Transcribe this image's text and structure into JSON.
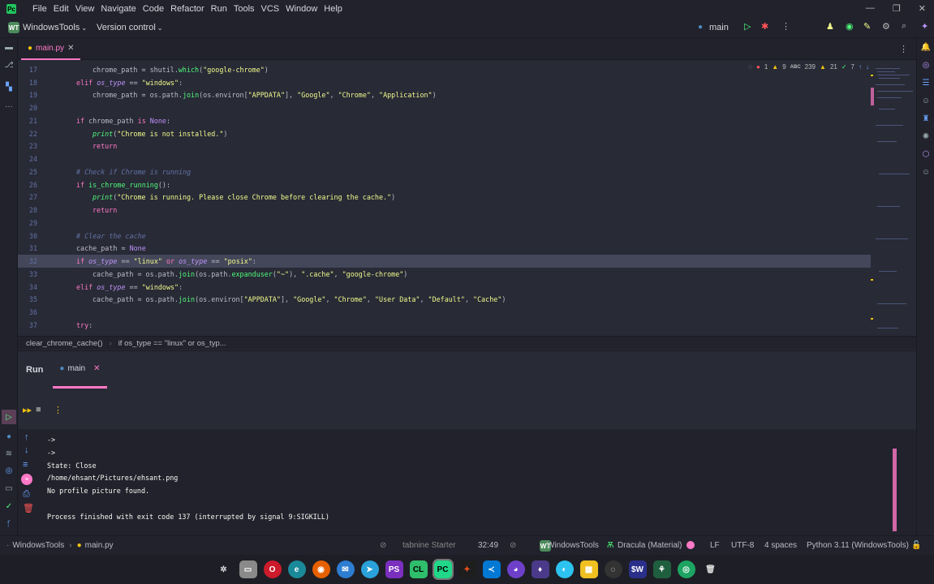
{
  "menu": [
    "File",
    "Edit",
    "View",
    "Navigate",
    "Code",
    "Refactor",
    "Run",
    "Tools",
    "VCS",
    "Window",
    "Help"
  ],
  "toolbar": {
    "project_badge": "WT",
    "project": "WindowsTools",
    "vcs": "Version control",
    "run_config": "main"
  },
  "tab": {
    "filename": "main.py"
  },
  "inspections": {
    "errors": "1",
    "warnings": "9",
    "typos": "239",
    "weak": "21",
    "ok": "7"
  },
  "lines": [
    {
      "n": "17",
      "cur": false,
      "html": "<span style='margin-left:20px'></span>chrome_path = shutil.<span class='fn'>which</span>(<span class='str'>\"google-chrome\"</span>)"
    },
    {
      "n": "18",
      "cur": false,
      "html": "<span class='kw'>elif</span> <span class='var'>os_type</span> == <span class='str'>\"windows\"</span>:"
    },
    {
      "n": "19",
      "cur": false,
      "html": "<span style='margin-left:20px'></span>chrome_path = os.path.<span class='fn'>join</span>(os.environ[<span class='str'>\"APPDATA\"</span>], <span class='str'>\"Google\"</span>, <span class='str'>\"Chrome\"</span>, <span class='str'>\"Application\"</span>)"
    },
    {
      "n": "20",
      "cur": false,
      "html": ""
    },
    {
      "n": "21",
      "cur": false,
      "html": "<span class='kw'>if</span> chrome_path <span class='kw'>is</span> <span class='nn'>None</span>:"
    },
    {
      "n": "22",
      "cur": false,
      "html": "<span style='margin-left:20px'></span><span class='pf'>print</span>(<span class='str'>\"Chrome is not installed.\"</span>)"
    },
    {
      "n": "23",
      "cur": false,
      "html": "<span style='margin-left:20px'></span><span class='kw'>return</span>"
    },
    {
      "n": "24",
      "cur": false,
      "html": ""
    },
    {
      "n": "25",
      "cur": false,
      "html": "<span class='cm'># Check if Chrome is running</span>"
    },
    {
      "n": "26",
      "cur": false,
      "html": "<span class='kw'>if</span> <span class='fn'>is_chrome_running</span>():"
    },
    {
      "n": "27",
      "cur": false,
      "html": "<span style='margin-left:20px'></span><span class='pf'>print</span>(<span class='str'>\"Chrome is running. Please close Chrome before clearing the cache.\"</span>)"
    },
    {
      "n": "28",
      "cur": false,
      "html": "<span style='margin-left:20px'></span><span class='kw'>return</span>"
    },
    {
      "n": "29",
      "cur": false,
      "html": ""
    },
    {
      "n": "30",
      "cur": false,
      "html": "<span class='cm'># Clear the cache</span>"
    },
    {
      "n": "31",
      "cur": false,
      "html": "cache_path = <span class='nn'>None</span>"
    },
    {
      "n": "32",
      "cur": true,
      "html": "<span class='kw'>if</span> <span class='var'>os_type</span> == <span class='str'>\"linux\"</span> <span class='kw'>or</span> <span class='var'>os_type</span> == <span class='str'>\"posix\"</span>:"
    },
    {
      "n": "33",
      "cur": false,
      "html": "<span style='margin-left:20px'></span>cache_path = os.path.<span class='fn'>join</span>(os.path.<span class='fn'>expanduser</span>(<span class='str'>\"~\"</span>), <span class='str'>\".cache\"</span>, <span class='str'>\"google-chrome\"</span>)"
    },
    {
      "n": "34",
      "cur": false,
      "html": "<span class='kw'>elif</span> <span class='var'>os_type</span> == <span class='str'>\"windows\"</span>:"
    },
    {
      "n": "35",
      "cur": false,
      "html": "<span style='margin-left:20px'></span>cache_path = os.path.<span class='fn'>join</span>(os.environ[<span class='str'>\"APPDATA\"</span>], <span class='str'>\"Google\"</span>, <span class='str'>\"Chrome\"</span>, <span class='str'>\"User Data\"</span>, <span class='str'>\"Default\"</span>, <span class='str'>\"Cache\"</span>)"
    },
    {
      "n": "36",
      "cur": false,
      "html": ""
    },
    {
      "n": "37",
      "cur": false,
      "html": "<span class='kw'>try</span>:"
    }
  ],
  "breadcrumb": {
    "func": "clear_chrome_cache()",
    "cond": "if os_type == \"linux\" or os_typ..."
  },
  "run": {
    "title": "Run",
    "tab": "main"
  },
  "console": "->\n->\nState: Close\n/home/ehsant/Pictures/ehsant.png\nNo profile picture found.\n\nProcess finished with exit code 137 (interrupted by signal 9:SIGKILL)",
  "status": {
    "project": "WindowsTools",
    "file": "main.py",
    "tabnine": "tabnine Starter",
    "position": "32:49",
    "project_badge": "WT",
    "project2": "WindowsTools",
    "theme": "Dracula (Material)",
    "line_sep": "LF",
    "encoding": "UTF-8",
    "indent": "4 spaces",
    "interpreter": "Python 3.11 (WindowsTools)"
  },
  "taskbar_apps": [
    "kde",
    "files",
    "opera",
    "edge",
    "firefox",
    "thunderbird",
    "telegram",
    "pycharm-ps",
    "clion",
    "pycharm",
    "figma",
    "vscode",
    "github",
    "kleopatra",
    "browser",
    "tiles",
    "mail",
    "webstorm",
    "git",
    "chrome",
    "trash"
  ],
  "colors": {
    "accent": "#ff79c6",
    "bg": "#282a36",
    "panel": "#21222c"
  }
}
